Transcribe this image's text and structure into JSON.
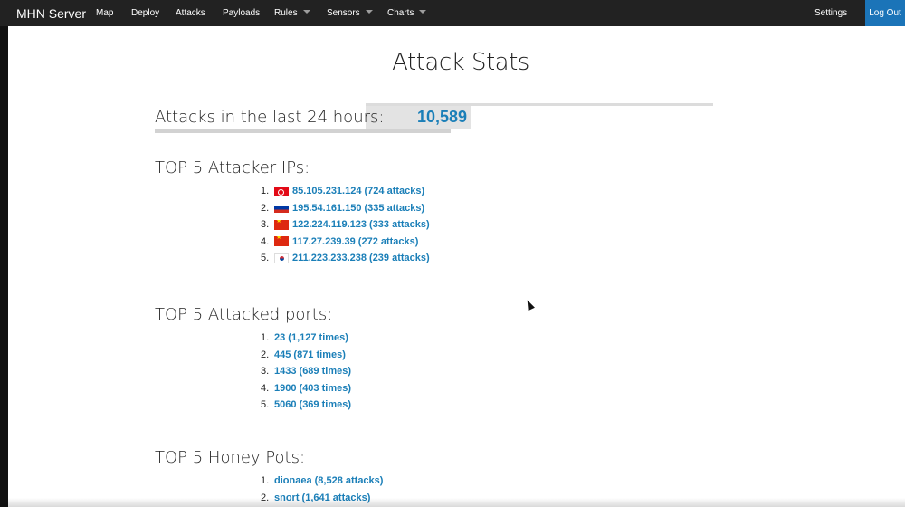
{
  "navbar": {
    "brand": "MHN Server",
    "items": [
      {
        "label": "Map",
        "dropdown": false
      },
      {
        "label": "Deploy",
        "dropdown": false
      },
      {
        "label": "Attacks",
        "dropdown": false
      },
      {
        "label": "Payloads",
        "dropdown": false
      },
      {
        "label": "Rules",
        "dropdown": true
      },
      {
        "label": "Sensors",
        "dropdown": true
      },
      {
        "label": "Charts",
        "dropdown": true
      }
    ],
    "settings": "Settings",
    "logout": "Log Out"
  },
  "colors": {
    "navbar_bg": "#222222",
    "accent": "#1b74b8",
    "link": "#1b7fb8"
  },
  "page_title": "Attack Stats",
  "attacks_24h": {
    "label": "Attacks in the last 24 hours:",
    "value": "10,589"
  },
  "top_ips": {
    "heading": "TOP 5 Attacker IPs:",
    "items": [
      {
        "num": "1.",
        "flag": "flag-turkey",
        "text": "85.105.231.124 (724 attacks)"
      },
      {
        "num": "2.",
        "flag": "flag-russia",
        "text": "195.54.161.150 (335 attacks)"
      },
      {
        "num": "3.",
        "flag": "flag-china",
        "text": "122.224.119.123 (333 attacks)"
      },
      {
        "num": "4.",
        "flag": "flag-china",
        "text": "117.27.239.39 (272 attacks)"
      },
      {
        "num": "5.",
        "flag": "flag-south-korea",
        "text": "211.223.233.238 (239 attacks)"
      }
    ]
  },
  "top_ports": {
    "heading": "TOP 5 Attacked ports:",
    "items": [
      {
        "num": "1.",
        "text": "23 (1,127 times)"
      },
      {
        "num": "2.",
        "text": "445 (871 times)"
      },
      {
        "num": "3.",
        "text": "1433 (689 times)"
      },
      {
        "num": "4.",
        "text": "1900 (403 times)"
      },
      {
        "num": "5.",
        "text": "5060 (369 times)"
      }
    ]
  },
  "top_honeypots": {
    "heading": "TOP 5 Honey Pots:",
    "items": [
      {
        "num": "1.",
        "text": "dionaea (8,528 attacks)"
      },
      {
        "num": "2.",
        "text": "snort (1,641 attacks)"
      }
    ]
  }
}
